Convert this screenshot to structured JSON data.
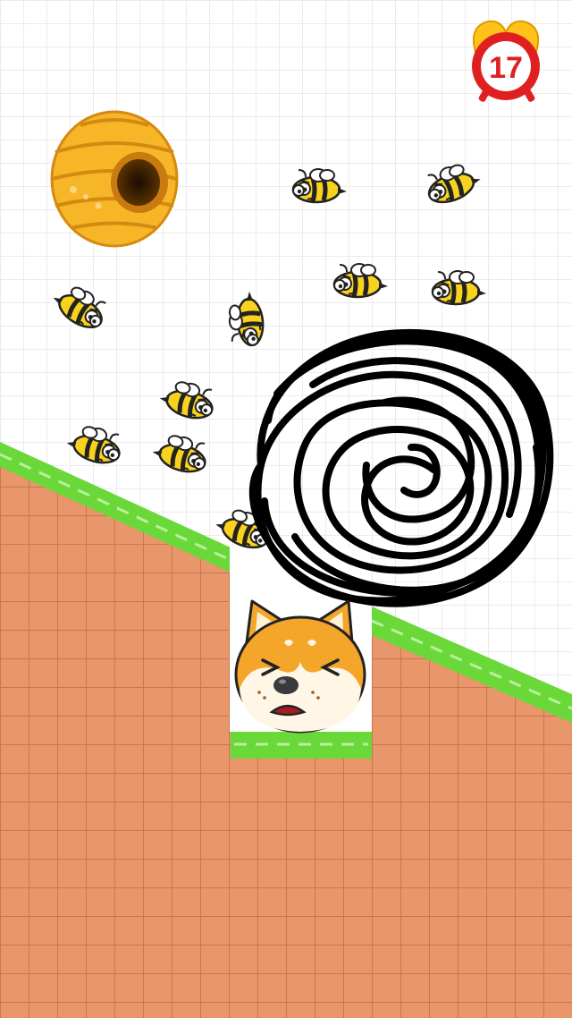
{
  "timer": {
    "seconds_left": "17",
    "ring_color": "#e02020",
    "bell_color": "#ffc21a"
  },
  "colors": {
    "background": "#ffffff",
    "grid": "#e6e6e6",
    "grass": "#6bd83a",
    "grass_dash": "#b9f09a",
    "dirt": "#e8966a",
    "dirt_grid": "#c97752",
    "ink": "#000000",
    "hive": "#f7b528",
    "bee_body": "#f8d21d"
  },
  "objects": {
    "hive": "beehive",
    "bee_count": 12,
    "character": "shiba-inu-dog",
    "character_expression": "scared"
  }
}
